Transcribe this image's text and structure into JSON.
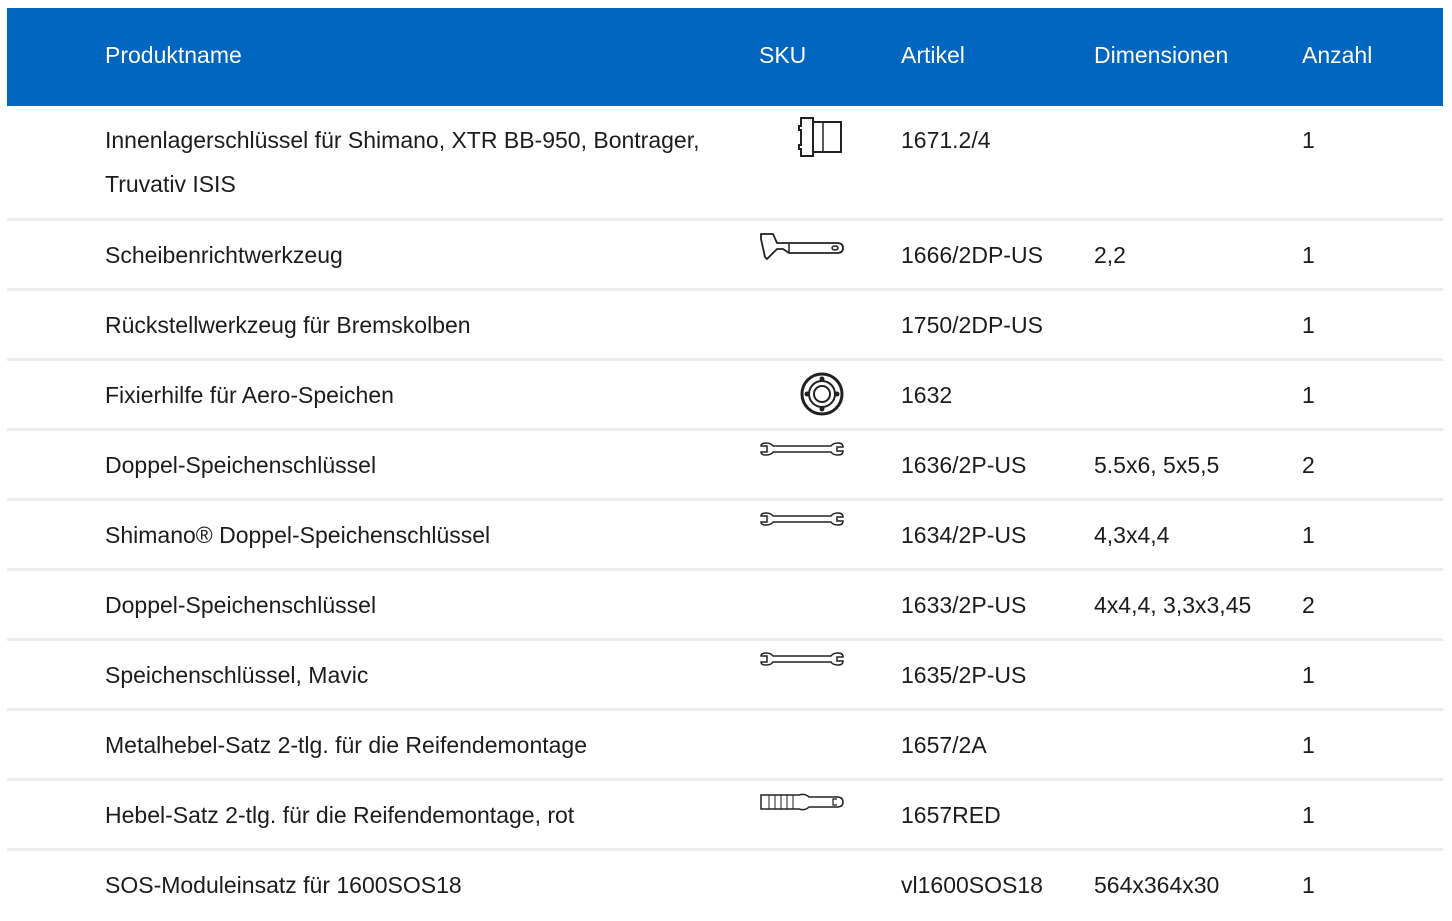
{
  "header": {
    "product_name": "Produktname",
    "sku": "SKU",
    "article": "Artikel",
    "dimensions": "Dimensionen",
    "quantity": "Anzahl"
  },
  "rows": [
    {
      "name": "Innenlagerschlüssel für Shimano, XTR BB-950, Bontrager, Truvativ ISIS",
      "icon": "bottom-bracket-tool-icon",
      "article": "1671.2/4",
      "dimensions": "",
      "quantity": "1"
    },
    {
      "name": "Scheibenrichtwerkzeug",
      "icon": "disc-straightening-tool-icon",
      "article": "1666/2DP-US",
      "dimensions": "2,2",
      "quantity": "1"
    },
    {
      "name": "Rückstellwerkzeug für Bremskolben",
      "icon": "",
      "article": "1750/2DP-US",
      "dimensions": "",
      "quantity": "1"
    },
    {
      "name": "Fixierhilfe für Aero-Speichen",
      "icon": "aero-spoke-holder-icon",
      "article": "1632",
      "dimensions": "",
      "quantity": "1"
    },
    {
      "name": "Doppel-Speichenschlüssel",
      "icon": "spoke-wrench-icon",
      "article": "1636/2P-US",
      "dimensions": "5.5x6, 5x5,5",
      "quantity": "2"
    },
    {
      "name": "Shimano® Doppel-Speichenschlüssel",
      "icon": "spoke-wrench-icon",
      "article": "1634/2P-US",
      "dimensions": "4,3x4,4",
      "quantity": "1"
    },
    {
      "name": "Doppel-Speichenschlüssel",
      "icon": "",
      "article": "1633/2P-US",
      "dimensions": "4x4,4, 3,3x3,45",
      "quantity": "2"
    },
    {
      "name": "Speichenschlüssel, Mavic",
      "icon": "spoke-wrench-icon",
      "article": "1635/2P-US",
      "dimensions": "",
      "quantity": "1"
    },
    {
      "name": "Metalhebel-Satz 2-tlg. für die Reifendemontage",
      "icon": "",
      "article": "1657/2A",
      "dimensions": "",
      "quantity": "1"
    },
    {
      "name": "Hebel-Satz 2-tlg. für die Reifendemontage, rot",
      "icon": "tire-lever-icon",
      "article": "1657RED",
      "dimensions": "",
      "quantity": "1"
    },
    {
      "name": "SOS-Moduleinsatz für 1600SOS18",
      "icon": "",
      "article": "vl1600SOS18",
      "dimensions": "564x364x30",
      "quantity": "1"
    }
  ],
  "colors": {
    "header_bg": "#0066c0",
    "header_text": "#ffffff",
    "row_divider": "#ececec"
  }
}
